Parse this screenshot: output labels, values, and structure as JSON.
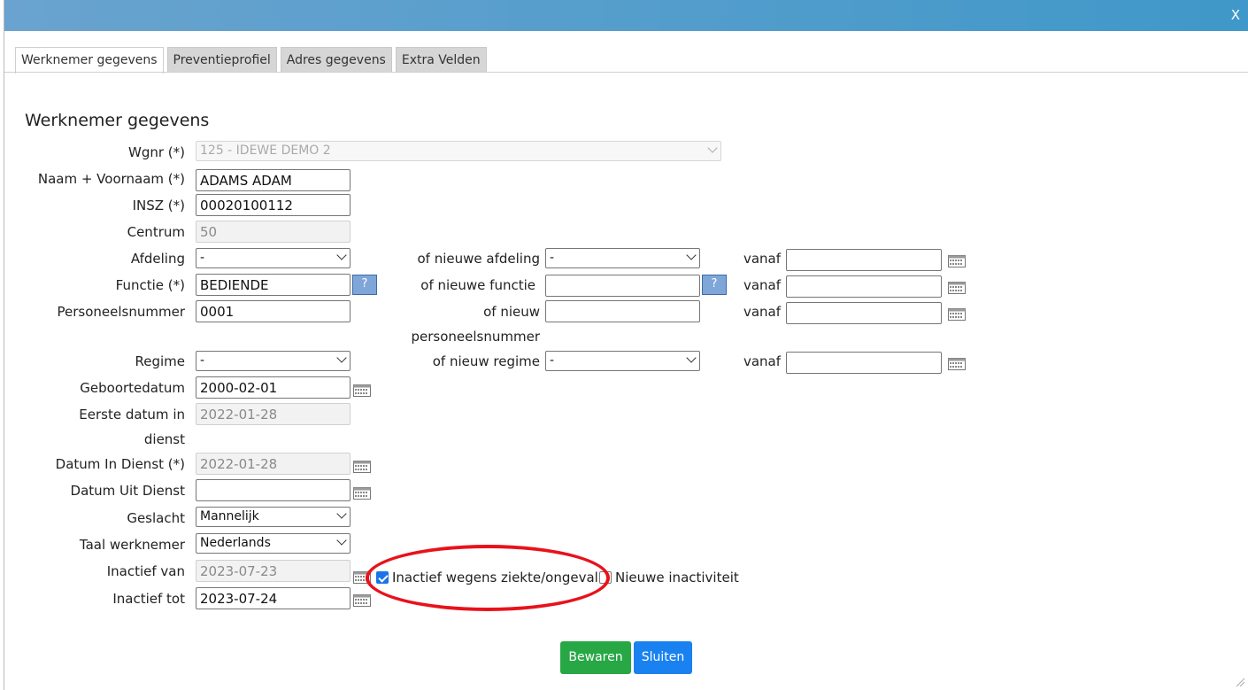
{
  "window": {
    "close_label": "X"
  },
  "tabs": [
    {
      "label": "Werknemer gegevens",
      "active": true
    },
    {
      "label": "Preventieprofiel",
      "active": false
    },
    {
      "label": "Adres gegevens",
      "active": false
    },
    {
      "label": "Extra Velden",
      "active": false
    }
  ],
  "heading": "Werknemer gegevens",
  "form": {
    "wgnr": {
      "label": "Wgnr (*)",
      "value": "125 - IDEWE DEMO 2"
    },
    "naam": {
      "label": "Naam + Voornaam (*)",
      "value": "ADAMS ADAM"
    },
    "insz": {
      "label": "INSZ (*)",
      "value": "00020100112"
    },
    "centrum": {
      "label": "Centrum",
      "value": "50"
    },
    "afdeling": {
      "label": "Afdeling",
      "value": "-",
      "new_label": "of nieuwe afdeling",
      "new_value": "-",
      "vanaf_label": "vanaf",
      "vanaf_value": ""
    },
    "functie": {
      "label": "Functie (*)",
      "value": "BEDIENDE",
      "help": "?",
      "new_label": "of nieuwe functie",
      "new_value": "",
      "new_help": "?",
      "vanaf_label": "vanaf",
      "vanaf_value": ""
    },
    "personeelsnummer": {
      "label": "Personeelsnummer",
      "value": "0001",
      "new_label_1": "of nieuw",
      "new_label_2": "personeelsnummer",
      "new_value": "",
      "vanaf_label": "vanaf",
      "vanaf_value": ""
    },
    "regime": {
      "label": "Regime",
      "value": "-",
      "new_label": "of nieuw regime",
      "new_value": "-",
      "vanaf_label": "vanaf",
      "vanaf_value": ""
    },
    "geboortedatum": {
      "label": "Geboortedatum",
      "value": "2000-02-01"
    },
    "eerste_datum": {
      "label_1": "Eerste datum in",
      "label_2": "dienst",
      "value": "2022-01-28"
    },
    "datum_in_dienst": {
      "label": "Datum In Dienst (*)",
      "value": "2022-01-28"
    },
    "datum_uit_dienst": {
      "label": "Datum Uit Dienst",
      "value": ""
    },
    "geslacht": {
      "label": "Geslacht",
      "value": "Mannelijk"
    },
    "taal": {
      "label": "Taal werknemer",
      "value": "Nederlands"
    },
    "inactief_van": {
      "label": "Inactief van",
      "value": "2023-07-23"
    },
    "inactief_tot": {
      "label": "Inactief tot",
      "value": "2023-07-24"
    },
    "inactief_ziekte": {
      "label": "Inactief wegens ziekte/ongeval",
      "checked": true
    },
    "nieuwe_inactiviteit": {
      "label": "Nieuwe inactiviteit",
      "checked": false
    }
  },
  "buttons": {
    "save": "Bewaren",
    "close": "Sluiten"
  },
  "colors": {
    "titlebar": "#4a9ccc",
    "save_button": "#28a745",
    "close_button": "#1a82f0",
    "highlight_ellipse": "#e8121b"
  }
}
